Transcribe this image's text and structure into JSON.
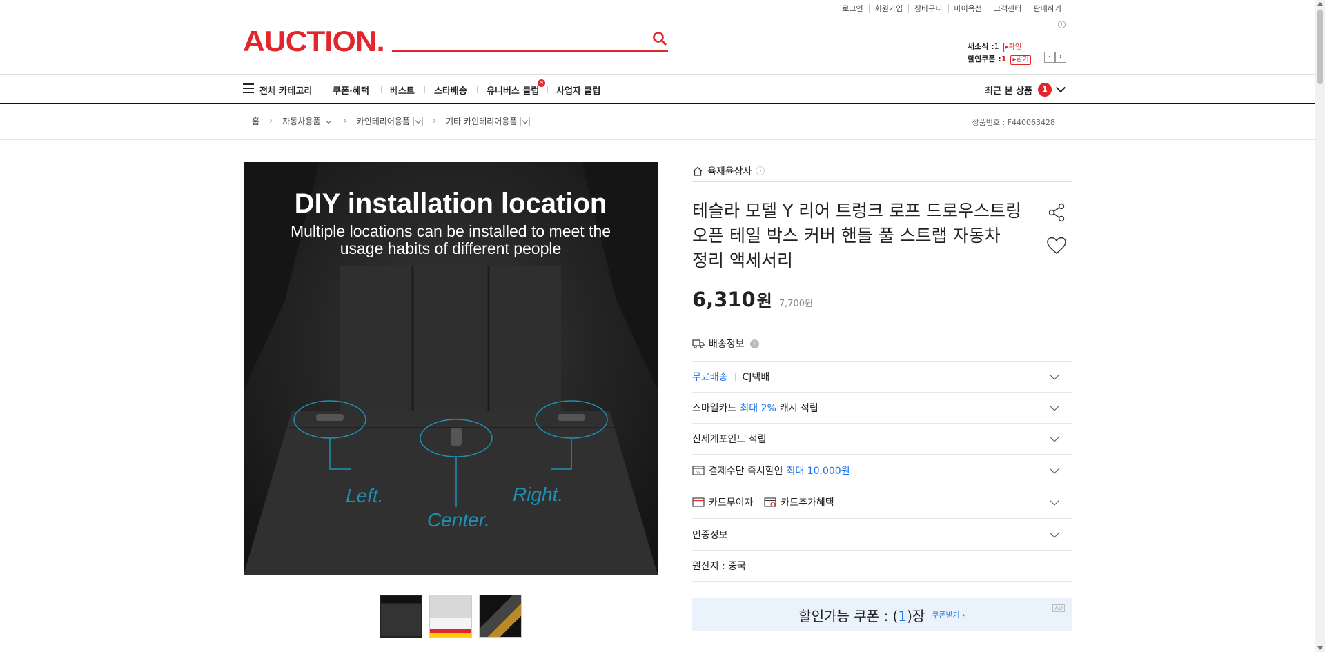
{
  "top_links": [
    "로그인",
    "회원가입",
    "장바구니",
    "마이옥션",
    "고객센터",
    "판매하기"
  ],
  "logo": "AUCTION.",
  "search": {
    "placeholder": ""
  },
  "mini": {
    "news_label": "새소식 :",
    "news_count": "1",
    "news_tag": "확인",
    "coupon_label": "할인쿠폰 :",
    "coupon_count": "1",
    "coupon_tag": "받기"
  },
  "nav": {
    "all_category": "전체 카테고리",
    "items": [
      "쿠폰·혜택",
      "베스트",
      "스타배송",
      "유니버스 클럽",
      "사업자 클럽"
    ],
    "new_badge": "N",
    "recent_label": "최근 본 상품",
    "recent_count": "1"
  },
  "breadcrumb": {
    "home": "홈",
    "levels": [
      "자동차용품",
      "카인테리어용품",
      "기타 카인테리어용품"
    ]
  },
  "product_code": "상품번호 : F440063428",
  "image": {
    "headline": "DIY installation location",
    "subline": "Multiple locations can be installed to meet the usage habits of different people",
    "labels": [
      "Left.",
      "Center.",
      "Right."
    ]
  },
  "seller": "육재윤상사",
  "title": "테슬라 모델 Y 리어 트렁크 로프 드로우스트링 오픈 테일 박스 커버 핸들 풀 스트랩 자동차 정리 액세서리",
  "price": {
    "value": "6,310",
    "unit": "원",
    "original": "7,700원"
  },
  "shipping_header": "배송정보",
  "rows": {
    "free_ship": "무료배송",
    "carrier": "CJ택배",
    "smile_a": "스마일카드",
    "smile_b": "최대 2%",
    "smile_c": "캐시 적립",
    "ssg": "신세계포인트 적립",
    "pay_a": "결제수단 즉시할인",
    "pay_b": "최대 10,000원",
    "card_a": "카드무이자",
    "card_b": "카드추가혜택",
    "cert": "인증정보",
    "origin": "원산지 : 중국"
  },
  "coupon": {
    "prefix": "할인가능 쿠폰 : (",
    "count": "1",
    "suffix": ")장",
    "get": "쿠폰받기 ›",
    "ad": "AD"
  },
  "colors": {
    "brand": "#e1262c",
    "accent_blue": "#1a73e8"
  }
}
